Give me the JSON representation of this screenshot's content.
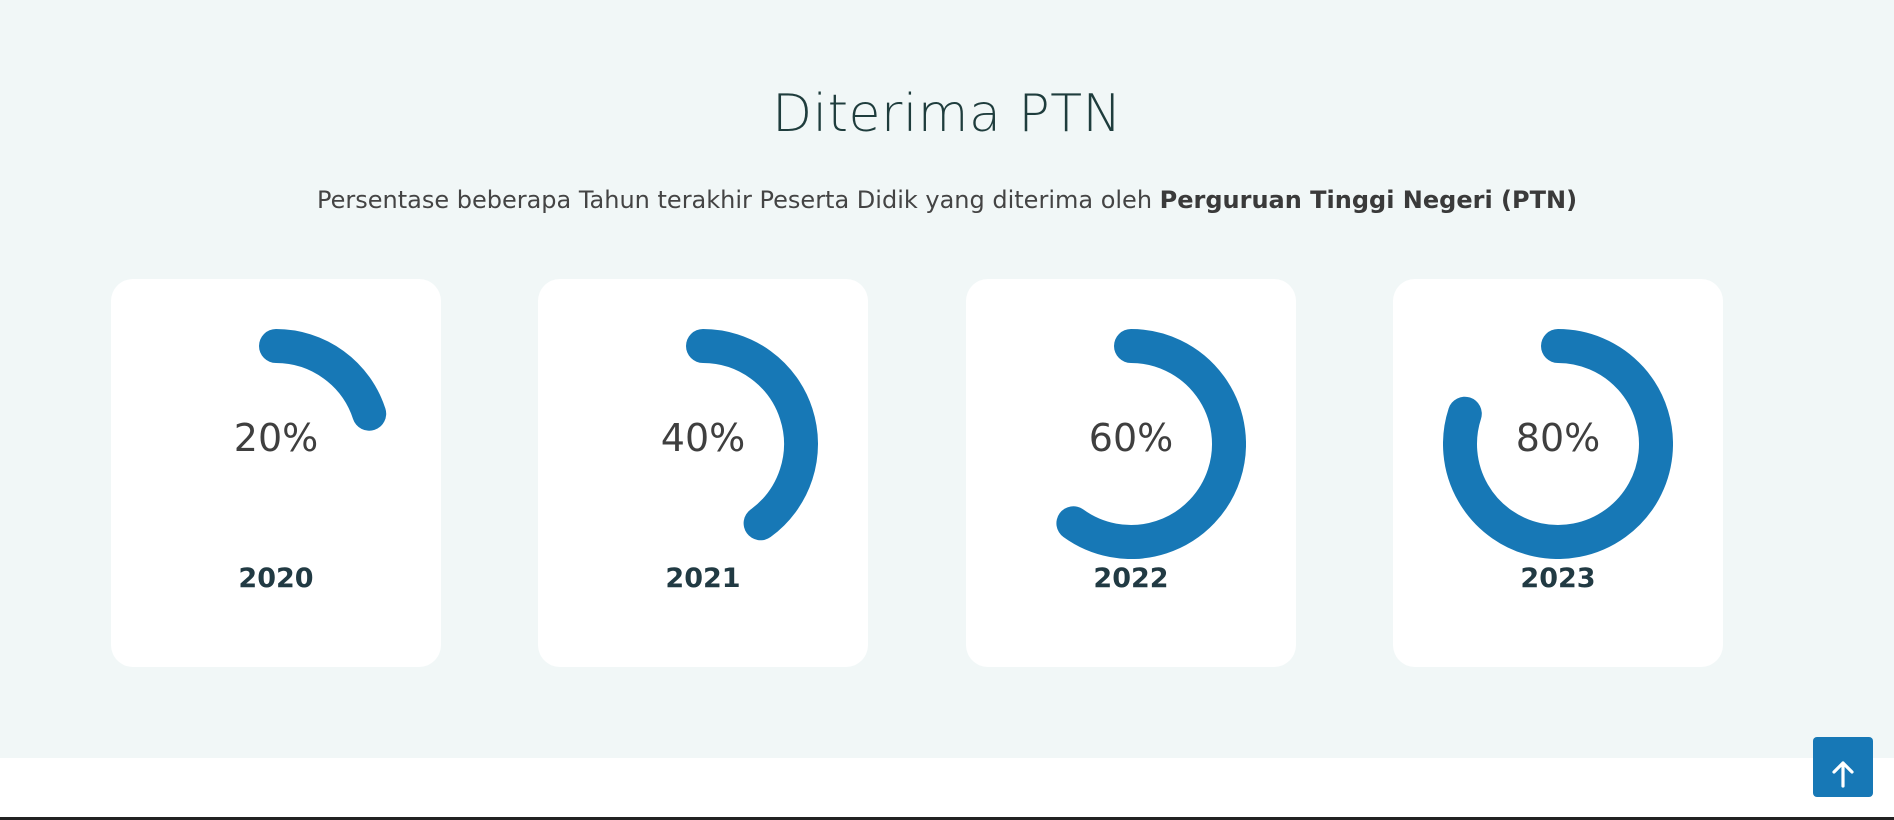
{
  "section": {
    "title": "Diterima PTN",
    "subtitle_prefix": "Persentase beberapa Tahun terakhir Peserta Didik yang diterima oleh ",
    "subtitle_bold": "Perguruan Tinggi Negeri (PTN)"
  },
  "cards": [
    {
      "value_label": "20%",
      "percent": 20,
      "year": "2020"
    },
    {
      "value_label": "40%",
      "percent": 40,
      "year": "2021"
    },
    {
      "value_label": "60%",
      "percent": 60,
      "year": "2022"
    },
    {
      "value_label": "80%",
      "percent": 80,
      "year": "2023"
    }
  ],
  "colors": {
    "accent": "#1778b6",
    "section_bg": "#f1f7f7",
    "card_bg": "#ffffff",
    "title": "#1f3d3d",
    "year_text": "#213a43"
  },
  "back_to_top": {
    "icon": "arrow-up-icon"
  }
}
